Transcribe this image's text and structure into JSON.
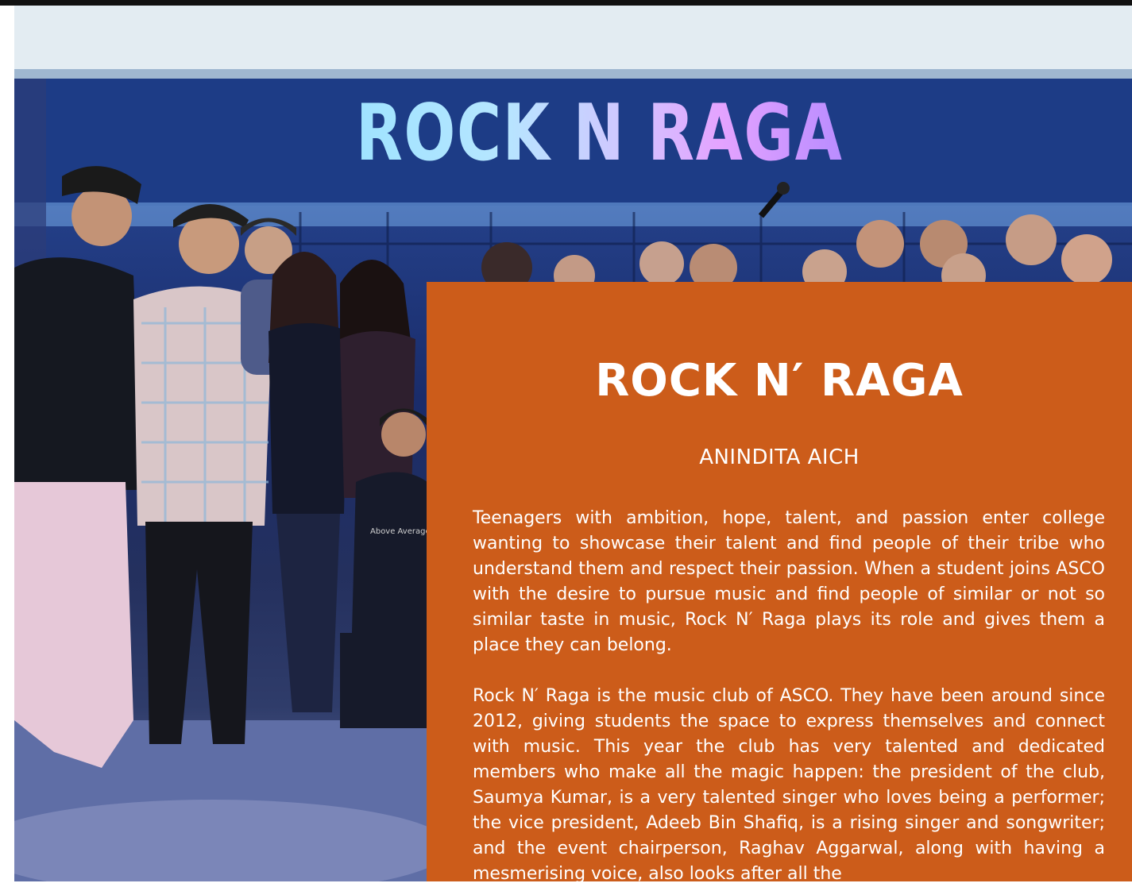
{
  "photo": {
    "banner_text": "ROCK N RAGA",
    "shirt_text": "Above Average"
  },
  "article": {
    "title": "ROCK N′ RAGA",
    "author": "ANINDITA AICH",
    "paragraphs": [
      "Teenagers with ambition, hope, talent, and passion enter college wanting to showcase their talent and find people of their tribe who understand them and respect their passion. When a student joins ASCO with the desire to pursue music and find people of similar or not so similar taste in music, Rock N′ Raga plays its role and gives them a place they can belong.",
      "Rock N′ Raga is the music club of ASCO. They have been around since 2012, giving students the space to express themselves and connect with music. This year the club has very talented and dedicated members who make all the magic happen: the president of the club, Saumya Kumar, is a very talented singer who loves being a performer; the vice president, Adeeb Bin Shafiq, is a rising singer and songwriter; and the event chairperson, Raghav Aggarwal, along with having a mesmerising voice, also looks after all the"
    ]
  },
  "colors": {
    "panel": "#cc5c1a",
    "text": "#ffffff"
  }
}
